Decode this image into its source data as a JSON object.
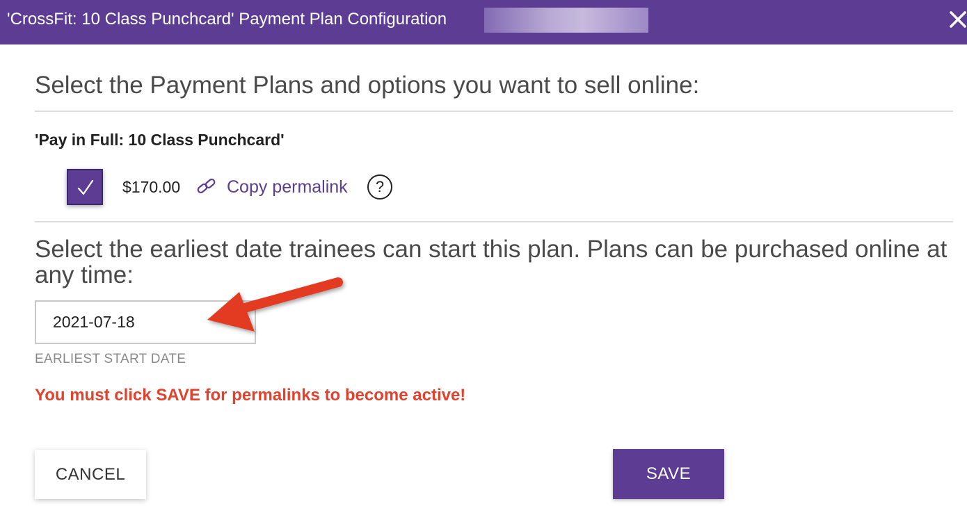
{
  "dialog": {
    "title": "'CrossFit: 10 Class Punchcard' Payment Plan Configuration",
    "close_icon": "close-icon"
  },
  "plans_section": {
    "heading": "Select the Payment Plans and options you want to sell online:",
    "plan_name": "'Pay in Full: 10 Class Punchcard'",
    "plan_checked": true,
    "price": "$170.00",
    "permalink_label": "Copy permalink",
    "help_symbol": "?"
  },
  "start_date_section": {
    "heading": "Select the earliest date trainees can start this plan.  Plans can be purchased online at any time:",
    "date_value": "2021-07-18",
    "date_label": "EARLIEST START DATE"
  },
  "warning": "You must click SAVE for permalinks to become active!",
  "buttons": {
    "cancel_label": "CANCEL",
    "save_label": "SAVE"
  },
  "colors": {
    "brand_purple": "#5d3c93",
    "warning_red": "#e0422d",
    "annotation_arrow": "#e33a22"
  }
}
